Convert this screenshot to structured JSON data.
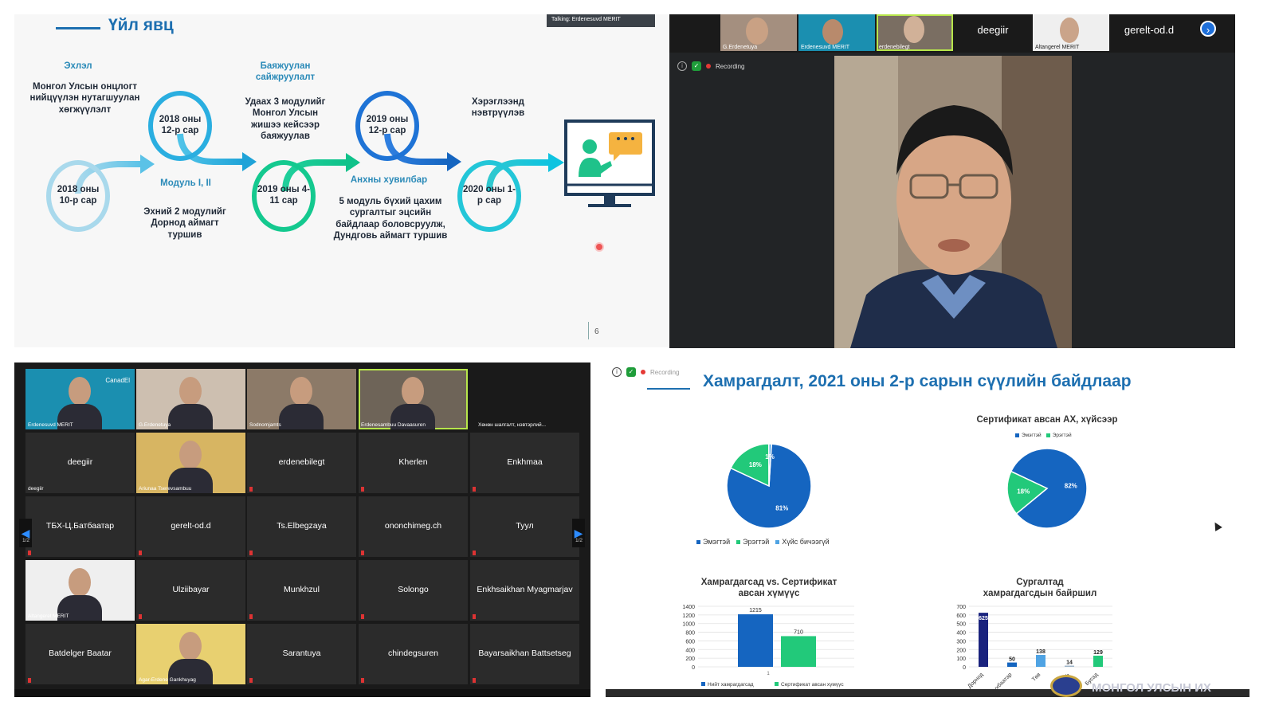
{
  "slide1": {
    "title": "Үйл явц",
    "talking": "Talking: Erdenesuvd MERIT",
    "stages": [
      {
        "date": "2018 оны 10-р сар",
        "heading": "Эхлэл",
        "desc": "Монгол Улсын онцлогт нийцүүлэн нутагшуулан хөгжүүлэлт"
      },
      {
        "date": "2018 оны 12-р сар",
        "heading": "Модуль I, II",
        "desc": "Эхний 2 модулийг Дорнод аймагт туршив"
      },
      {
        "date": "2019 оны 4-11 сар",
        "heading": "Баяжуулан сайжруулалт",
        "desc": "Удаах 3 модулийг Монгол Улсын жишээ кейсээр баяжуулав"
      },
      {
        "date": "2019 оны 12-р сар",
        "heading": "Анхны хувилбар",
        "desc": "5 модуль бүхий цахим сургалтыг эцсийн байдлаар боловсруулж, Дундговь аймагт туршив"
      },
      {
        "date": "2020 оны 1-р сар",
        "heading": "Хэрэглээнд нэвтрүүлэв",
        "desc": ""
      }
    ],
    "page_number": "6",
    "icon": "presentation-screen-icon"
  },
  "speaker_view": {
    "thumbnails": [
      {
        "name": "G.Erdenetuya",
        "type": "video"
      },
      {
        "name": "Erdenesuvd MERIT",
        "type": "video"
      },
      {
        "name": "erdenebilegt",
        "type": "video"
      },
      {
        "name": "deegiir",
        "type": "name"
      },
      {
        "name": "Altangerel MERIT",
        "type": "video"
      },
      {
        "name": "gerelt-od.d",
        "type": "name"
      }
    ],
    "recording_label": "Recording",
    "next_icon": "chevron-right-icon"
  },
  "gallery": {
    "rows": [
      [
        {
          "label": "Erdenesuvd MERIT",
          "video": true,
          "brand": "CanadEl"
        },
        {
          "label": "G.Erdenetuya",
          "video": true
        },
        {
          "label": "Sodnomjamts",
          "video": true
        },
        {
          "label": "Erdenesambuu Davaasuren",
          "video": true,
          "highlight": true
        },
        {
          "label": "Хөнөн шалгалт, нэвтэрлий...",
          "video": false,
          "caption_only": true
        }
      ],
      [
        {
          "label": "deegiir",
          "small": "deegiir"
        },
        {
          "label": "Ariunaa Tserevsambuu",
          "video": true
        },
        {
          "label": "erdenebilegt"
        },
        {
          "label": "Kherlen"
        },
        {
          "label": "Enkhmaa"
        }
      ],
      [
        {
          "label": "ТБХ-Ц.Батбаатар"
        },
        {
          "label": "gerelt-od.d"
        },
        {
          "label": "Ts.Elbegzaya"
        },
        {
          "label": "ononchimeg.ch"
        },
        {
          "label": "Туул"
        }
      ],
      [
        {
          "label": "Altangerel MERIT",
          "video": true
        },
        {
          "label": "Ulziibayar"
        },
        {
          "label": "Munkhzul"
        },
        {
          "label": "Solongo"
        },
        {
          "label": "Enkhsaikhan Myagmarjav"
        }
      ],
      [
        {
          "label": "Batdelger Baatar"
        },
        {
          "label": "Agar-Erdene Gankhuyag",
          "video": true
        },
        {
          "label": "Sarantuya"
        },
        {
          "label": "chindegsuren"
        },
        {
          "label": "Bayarsaikhan Battsetseg"
        }
      ]
    ],
    "page_left": "1/2",
    "page_right": "1/2"
  },
  "slide2": {
    "title": "Хамрагдалт, 2021 оны 2-р сарын сүүлийн байдлаар",
    "recording_label": "Recording",
    "footer_logo": "МОНГОЛ УЛСЫН ИХ ХУРАЛ",
    "colors": {
      "blue": "#1565c0",
      "green": "#22c97a",
      "navy": "#1a237e",
      "light_blue": "#4fa3e3"
    }
  },
  "chart_data": [
    {
      "type": "pie",
      "title": "",
      "labels": [
        "Эмэгтэй",
        "Эрэгтэй",
        "Хүйс бичээгүй"
      ],
      "values": [
        81,
        18,
        1
      ],
      "value_labels": [
        "81%",
        "18%",
        "1%"
      ],
      "colors": [
        "#1565c0",
        "#22c97a",
        "#4fa3e3"
      ]
    },
    {
      "type": "pie",
      "title": "Сертификат авсан АХ, хүйсээр",
      "labels": [
        "Эмэгтэй",
        "Эрэгтэй"
      ],
      "values": [
        82,
        18
      ],
      "value_labels": [
        "82%",
        "18%"
      ],
      "colors": [
        "#1565c0",
        "#22c97a"
      ]
    },
    {
      "type": "bar",
      "title": "Хамрагдагсад vs. Сертификат авсан хүмүүс",
      "categories": [
        "1"
      ],
      "series": [
        {
          "name": "Нийт хамрагдагсад",
          "values": [
            1215
          ],
          "color": "#1565c0"
        },
        {
          "name": "Сертификат авсан хүмүүс",
          "values": [
            710
          ],
          "color": "#22c97a"
        }
      ],
      "ylim": [
        0,
        1400
      ],
      "yticks": [
        0,
        200,
        400,
        600,
        800,
        1000,
        1200,
        1400
      ]
    },
    {
      "type": "bar",
      "title": "Сургалтад хамрагдагсдын байршил",
      "categories": [
        "Дорнод",
        "Сүхбаатар",
        "Төв",
        "Дундговь",
        "Бусад"
      ],
      "values": [
        625,
        50,
        138,
        14,
        129
      ],
      "colors": [
        "#1a237e",
        "#1565c0",
        "#4fa3e3",
        "#9fb5c9",
        "#22c97a"
      ],
      "ylim": [
        0,
        700
      ],
      "yticks": [
        0,
        100,
        200,
        300,
        400,
        500,
        600,
        700
      ]
    }
  ]
}
